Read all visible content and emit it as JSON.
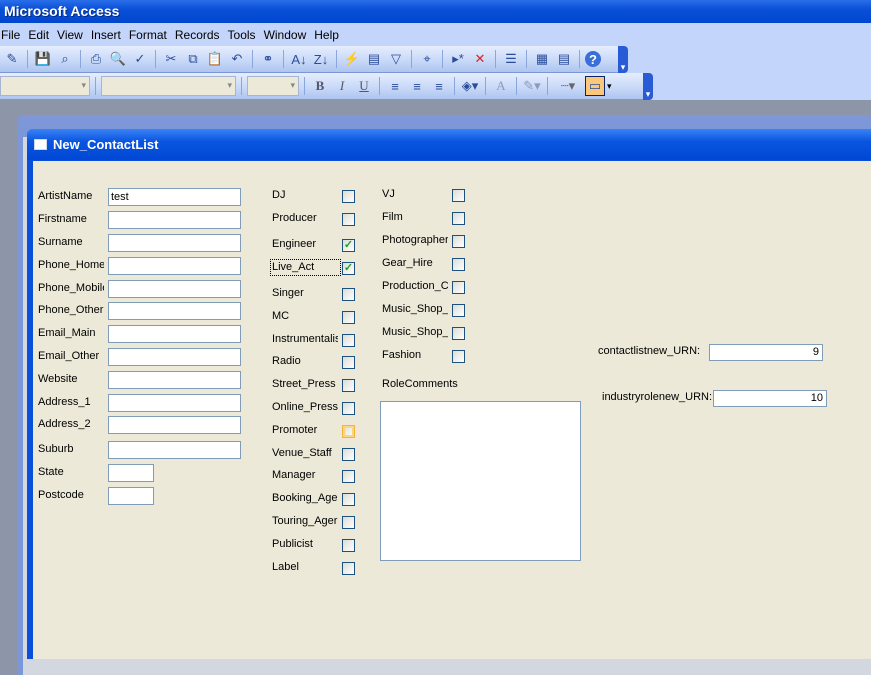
{
  "app": {
    "title": "Microsoft Access"
  },
  "menu": [
    "File",
    "Edit",
    "View",
    "Insert",
    "Format",
    "Records",
    "Tools",
    "Window",
    "Help"
  ],
  "toolbar_icons": [
    "design-view",
    "save",
    "file-search",
    "print",
    "print-preview",
    "spelling",
    "cut",
    "copy",
    "paste",
    "undo",
    "hyperlink",
    "sort-ascending",
    "sort-descending",
    "filter-by-selection",
    "filter-by-form",
    "apply-filter",
    "find",
    "new-record",
    "delete-record",
    "properties",
    "database-window",
    "new-object",
    "help"
  ],
  "format_toolbar": {
    "bold": "B",
    "italic": "I",
    "underline": "U",
    "font_color": "A"
  },
  "form": {
    "title": "New_ContactList",
    "fields": [
      {
        "label": "ArtistName",
        "value": "test"
      },
      {
        "label": "Firstname",
        "value": ""
      },
      {
        "label": "Surname",
        "value": ""
      },
      {
        "label": "Phone_Home",
        "value": ""
      },
      {
        "label": "Phone_Mobile",
        "value": ""
      },
      {
        "label": "Phone_Other",
        "value": ""
      },
      {
        "label": "Email_Main",
        "value": ""
      },
      {
        "label": "Email_Other",
        "value": ""
      },
      {
        "label": "Website",
        "value": ""
      },
      {
        "label": "Address_1",
        "value": ""
      },
      {
        "label": "Address_2",
        "value": ""
      },
      {
        "label": "Suburb",
        "value": ""
      },
      {
        "label": "State",
        "value": ""
      },
      {
        "label": "Postcode",
        "value": ""
      }
    ],
    "roles_col1": [
      {
        "label": "DJ",
        "checked": false
      },
      {
        "label": "Producer",
        "checked": false
      },
      {
        "label": "Engineer",
        "checked": true
      },
      {
        "label": "Live_Act",
        "checked": true
      },
      {
        "label": "Singer",
        "checked": false
      },
      {
        "label": "MC",
        "checked": false
      },
      {
        "label": "Instrumentalis",
        "checked": false
      },
      {
        "label": "Radio",
        "checked": false
      },
      {
        "label": "Street_Press",
        "checked": false
      },
      {
        "label": "Online_Press",
        "checked": false
      },
      {
        "label": "Promoter",
        "checked": false
      },
      {
        "label": "Venue_Staff",
        "checked": false
      },
      {
        "label": "Manager",
        "checked": false
      },
      {
        "label": "Booking_Age",
        "checked": false
      },
      {
        "label": "Touring_Ager",
        "checked": false
      },
      {
        "label": "Publicist",
        "checked": false
      },
      {
        "label": "Label",
        "checked": false
      }
    ],
    "roles_col2": [
      {
        "label": "VJ",
        "checked": false
      },
      {
        "label": "Film",
        "checked": false
      },
      {
        "label": "Photographer",
        "checked": false
      },
      {
        "label": "Gear_Hire",
        "checked": false
      },
      {
        "label": "Production_C",
        "checked": false
      },
      {
        "label": "Music_Shop_",
        "checked": false
      },
      {
        "label": "Music_Shop_",
        "checked": false
      },
      {
        "label": "Fashion",
        "checked": false
      }
    ],
    "role_comments": {
      "label": "RoleComments",
      "value": ""
    },
    "contactlist_urn": {
      "label": "contactlistnew_URN:",
      "value": "9"
    },
    "industryrole_urn": {
      "label": "industryrolenew_URN:",
      "value": "10"
    }
  }
}
